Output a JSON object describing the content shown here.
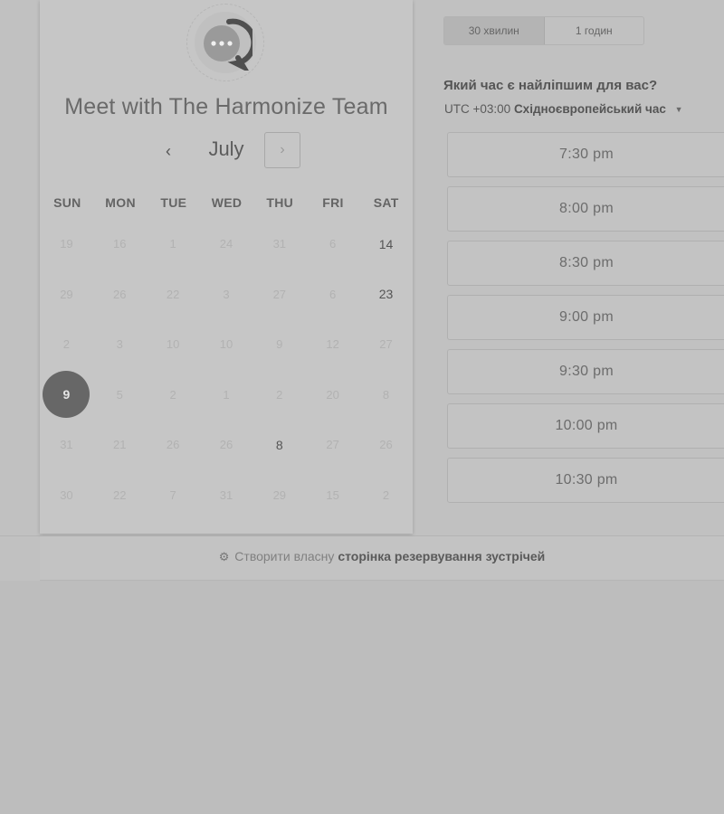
{
  "logo": {
    "icon": "chat-bubble-icon"
  },
  "title": "Meet with The Harmonize Team",
  "calendar": {
    "month": "July",
    "prev_icon": "‹",
    "next_icon": "›",
    "weekdays": [
      "SUN",
      "MON",
      "TUE",
      "WED",
      "THU",
      "FRI",
      "SAT"
    ],
    "weeks": [
      [
        {
          "d": "19",
          "a": false
        },
        {
          "d": "16",
          "a": false
        },
        {
          "d": "1",
          "a": false
        },
        {
          "d": "24",
          "a": false
        },
        {
          "d": "31",
          "a": false
        },
        {
          "d": "6",
          "a": false
        },
        {
          "d": "14",
          "a": true
        }
      ],
      [
        {
          "d": "29",
          "a": false
        },
        {
          "d": "26",
          "a": false
        },
        {
          "d": "22",
          "a": false
        },
        {
          "d": "3",
          "a": false
        },
        {
          "d": "27",
          "a": false
        },
        {
          "d": "6",
          "a": false
        },
        {
          "d": "23",
          "a": true
        }
      ],
      [
        {
          "d": "2",
          "a": false
        },
        {
          "d": "3",
          "a": false
        },
        {
          "d": "10",
          "a": false
        },
        {
          "d": "10",
          "a": false
        },
        {
          "d": "9",
          "a": false
        },
        {
          "d": "12",
          "a": false
        },
        {
          "d": "27",
          "a": false
        }
      ],
      [
        {
          "d": "9",
          "a": true,
          "s": true
        },
        {
          "d": "5",
          "a": false
        },
        {
          "d": "2",
          "a": false
        },
        {
          "d": "1",
          "a": false
        },
        {
          "d": "2",
          "a": false
        },
        {
          "d": "20",
          "a": false
        },
        {
          "d": "8",
          "a": false
        }
      ],
      [
        {
          "d": "31",
          "a": false
        },
        {
          "d": "21",
          "a": false
        },
        {
          "d": "26",
          "a": false
        },
        {
          "d": "26",
          "a": false
        },
        {
          "d": "8",
          "a": true
        },
        {
          "d": "27",
          "a": false
        },
        {
          "d": "26",
          "a": false
        }
      ],
      [
        {
          "d": "30",
          "a": false
        },
        {
          "d": "22",
          "a": false
        },
        {
          "d": "7",
          "a": false
        },
        {
          "d": "31",
          "a": false
        },
        {
          "d": "29",
          "a": false
        },
        {
          "d": "15",
          "a": false
        },
        {
          "d": "2",
          "a": false
        }
      ]
    ]
  },
  "durations": [
    {
      "label": "30 хвилин",
      "active": true
    },
    {
      "label": "1 годин",
      "active": false
    }
  ],
  "question": "Який час є найліпшим для вас?",
  "timezone": {
    "offset": "UTC +03:00",
    "name": "Східноєвропейський час"
  },
  "slots": [
    "7:30 pm",
    "8:00 pm",
    "8:30 pm",
    "9:00 pm",
    "9:30 pm",
    "10:00 pm",
    "10:30 pm"
  ],
  "footer": {
    "plain": "Створити власну",
    "strong": "сторінка резервування зустрічей",
    "icon": "sprocket-icon"
  },
  "colors": {
    "selected_day": "#676767",
    "background": "#bdbdbd"
  }
}
